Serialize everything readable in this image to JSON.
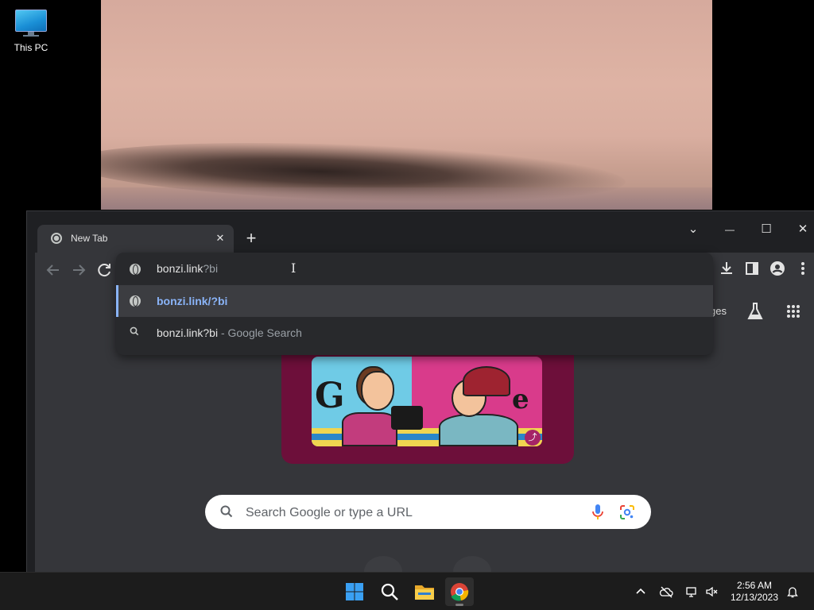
{
  "desktop": {
    "icon_label": "This PC"
  },
  "browser": {
    "tab_title": "New Tab",
    "tab_close": "✕",
    "new_tab": "+",
    "window_controls": {
      "list": "⌄",
      "minimize": "—",
      "maximize": "☐",
      "close": "✕"
    },
    "omnibox": {
      "typed_text": "bonzi.link",
      "autocomplete_text": "?bi",
      "suggestions": [
        {
          "icon": "globe-icon",
          "text": "bonzi.link/?bi",
          "selected": true
        },
        {
          "icon": "search-icon",
          "query": "bonzi.link?bi",
          "suffix": " - Google Search"
        }
      ]
    },
    "ntp": {
      "images_link_partial": "ges",
      "search_placeholder": "Search Google or type a URL",
      "doodle_share": "⤴"
    }
  },
  "taskbar": {
    "apps": [
      "windows-start-icon",
      "search-icon",
      "file-explorer-icon",
      "chrome-icon"
    ],
    "time": "2:56 AM",
    "date": "12/13/2023"
  },
  "colors": {
    "chrome_frame": "#1f2023",
    "chrome_toolbar": "#35363a",
    "accent_blue": "#8ab4f8",
    "doodle_bg": "#6d0f3a",
    "taskbar": "#1c1c1c"
  }
}
